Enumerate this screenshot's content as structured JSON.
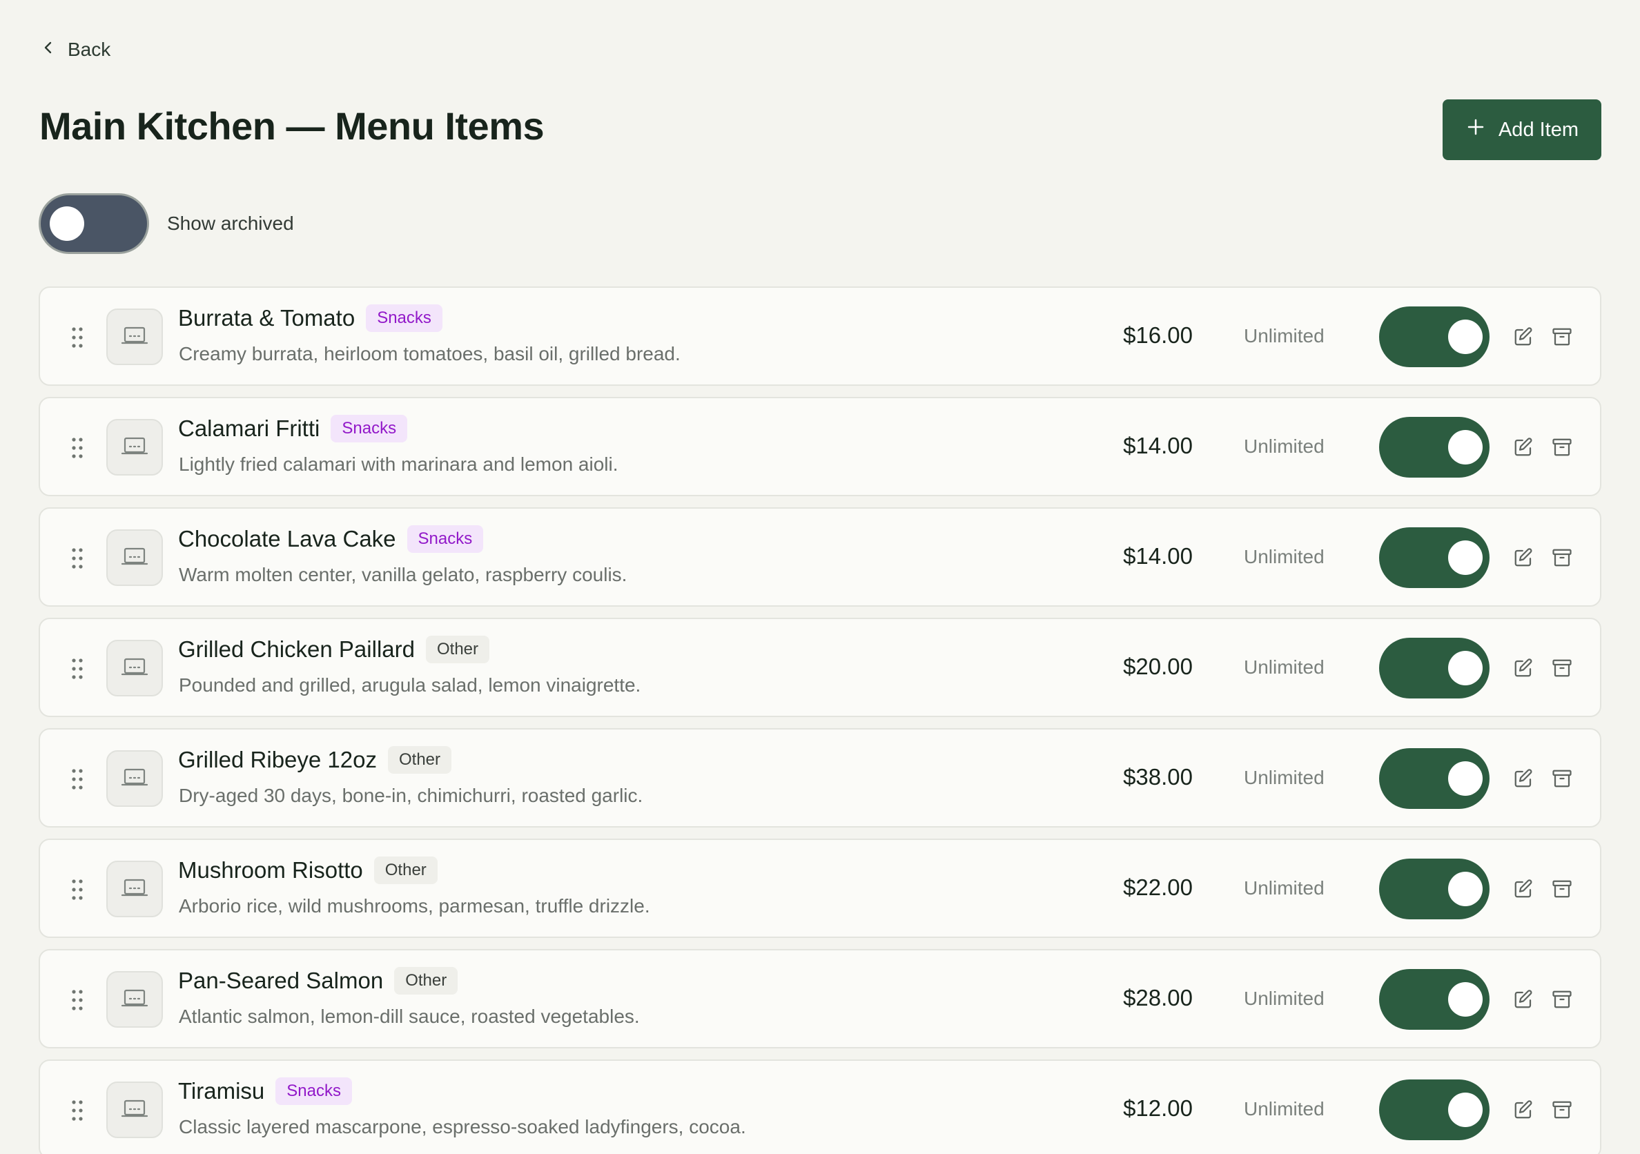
{
  "nav": {
    "back_label": "Back"
  },
  "header": {
    "title": "Main Kitchen — Menu Items",
    "add_label": "Add Item"
  },
  "filters": {
    "show_archived_label": "Show archived",
    "show_archived": false
  },
  "colors": {
    "accent": "#2c5c40",
    "snacks_tag": "#9219c9",
    "snacks_tag_bg": "#f3e5fb"
  },
  "items": [
    {
      "name": "Burrata & Tomato",
      "tag": "Snacks",
      "description": "Creamy burrata, heirloom tomatoes, basil oil, grilled bread.",
      "price": "$16.00",
      "stock": "Unlimited",
      "enabled": true
    },
    {
      "name": "Calamari Fritti",
      "tag": "Snacks",
      "description": "Lightly fried calamari with marinara and lemon aioli.",
      "price": "$14.00",
      "stock": "Unlimited",
      "enabled": true
    },
    {
      "name": "Chocolate Lava Cake",
      "tag": "Snacks",
      "description": "Warm molten center, vanilla gelato, raspberry coulis.",
      "price": "$14.00",
      "stock": "Unlimited",
      "enabled": true
    },
    {
      "name": "Grilled Chicken Paillard",
      "tag": "Other",
      "description": "Pounded and grilled, arugula salad, lemon vinaigrette.",
      "price": "$20.00",
      "stock": "Unlimited",
      "enabled": true
    },
    {
      "name": "Grilled Ribeye 12oz",
      "tag": "Other",
      "description": "Dry-aged 30 days, bone-in, chimichurri, roasted garlic.",
      "price": "$38.00",
      "stock": "Unlimited",
      "enabled": true
    },
    {
      "name": "Mushroom Risotto",
      "tag": "Other",
      "description": "Arborio rice, wild mushrooms, parmesan, truffle drizzle.",
      "price": "$22.00",
      "stock": "Unlimited",
      "enabled": true
    },
    {
      "name": "Pan-Seared Salmon",
      "tag": "Other",
      "description": "Atlantic salmon, lemon-dill sauce, roasted vegetables.",
      "price": "$28.00",
      "stock": "Unlimited",
      "enabled": true
    },
    {
      "name": "Tiramisu",
      "tag": "Snacks",
      "description": "Classic layered mascarpone, espresso-soaked ladyfingers, cocoa.",
      "price": "$12.00",
      "stock": "Unlimited",
      "enabled": true
    }
  ]
}
